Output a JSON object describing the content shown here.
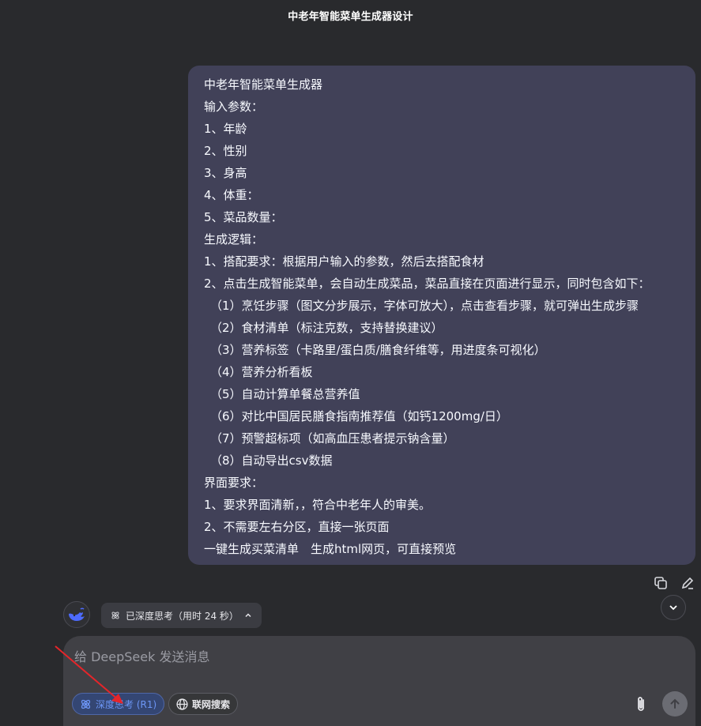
{
  "header": {
    "title": "中老年智能菜单生成器设计"
  },
  "user_message": {
    "lines": [
      {
        "text": "中老年智能菜单生成器",
        "indent": false
      },
      {
        "text": "输入参数：",
        "indent": false
      },
      {
        "text": "1、年龄",
        "indent": false
      },
      {
        "text": "2、性别",
        "indent": false
      },
      {
        "text": "3、身高",
        "indent": false
      },
      {
        "text": "4、体重：",
        "indent": false
      },
      {
        "text": "5、菜品数量：",
        "indent": false
      },
      {
        "text": "生成逻辑：",
        "indent": false
      },
      {
        "text": "1、搭配要求：根据用户输入的参数，然后去搭配食材",
        "indent": false
      },
      {
        "text": "2、点击生成智能菜单，会自动生成菜品，菜品直接在页面进行显示，同时包含如下：",
        "indent": false
      },
      {
        "text": "（1）烹饪步骤（图文分步展示，字体可放大），点击查看步骤，就可弹出生成步骤",
        "indent": true
      },
      {
        "text": "（2）食材清单（标注克数，支持替换建议）",
        "indent": true
      },
      {
        "text": "（3）营养标签（卡路里/蛋白质/膳食纤维等，用进度条可视化）",
        "indent": true
      },
      {
        "text": "（4）营养分析看板",
        "indent": true
      },
      {
        "text": "（5）自动计算单餐总营养值",
        "indent": true
      },
      {
        "text": "（6）对比中国居民膳食指南推荐值（如钙1200mg/日）",
        "indent": true
      },
      {
        "text": "（7）预警超标项（如高血压患者提示钠含量）",
        "indent": true
      },
      {
        "text": "（8）自动导出csv数据",
        "indent": true
      },
      {
        "text": "界面要求：",
        "indent": false
      },
      {
        "text": "1、要求界面清新，，符合中老年人的审美。",
        "indent": false
      },
      {
        "text": "2、不需要左右分区，直接一张页面",
        "indent": false
      },
      {
        "text": "一键生成买菜清单　生成html网页，可直接预览",
        "indent": false
      }
    ]
  },
  "message_actions": {
    "copy_icon": "copy-icon",
    "edit_icon": "edit-icon"
  },
  "assistant": {
    "avatar_icon": "whale-logo-icon",
    "thinking_label": "已深度思考（用时 24 秒）"
  },
  "composer": {
    "placeholder": "给 DeepSeek 发送消息",
    "value": "",
    "deep_think_label": "深度思考 (R1)",
    "web_search_label": "联网搜索"
  },
  "colors": {
    "background": "#292a2d",
    "bubble": "#414158",
    "accent": "#4d6bfe",
    "annotation": "#e5252a"
  }
}
